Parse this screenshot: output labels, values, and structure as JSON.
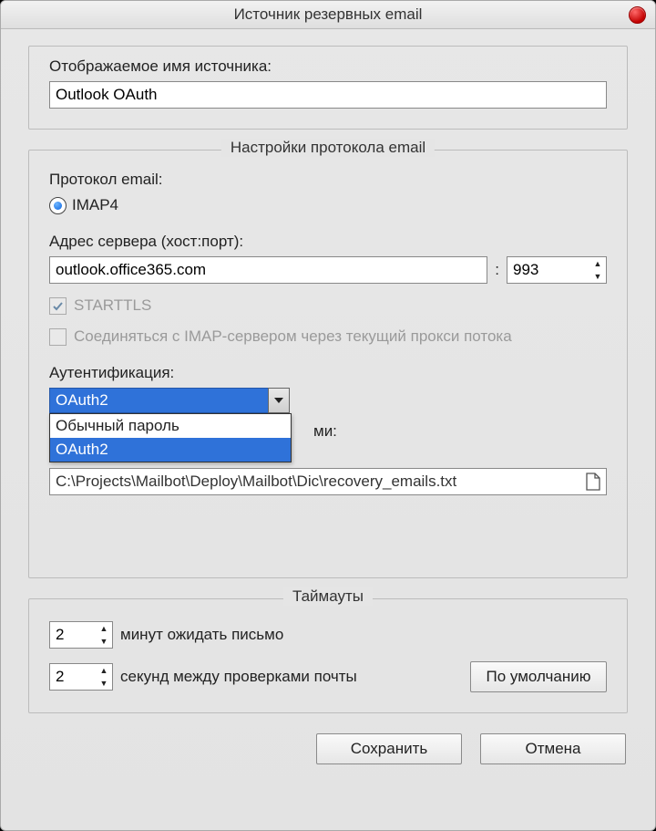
{
  "window": {
    "title": "Источник резервных email"
  },
  "source": {
    "name_label": "Отображаемое имя источника:",
    "name_value": "Outlook OAuth"
  },
  "protocol": {
    "legend": "Настройки протокола email",
    "protocol_label": "Протокол email:",
    "protocol_value": "IMAP4",
    "server_label": "Адрес сервера (хост:порт):",
    "host_value": "outlook.office365.com",
    "port_sep": ":",
    "port_value": "993",
    "starttls_label": "STARTTLS",
    "starttls_checked": true,
    "proxy_label": "Соединяться с IMAP-сервером через текущий прокси потока",
    "proxy_checked": false,
    "auth_label": "Аутентификация:",
    "auth_value": "OAuth2",
    "auth_options": [
      "Обычный пароль",
      "OAuth2"
    ],
    "file_label_partial": "ми:",
    "file_value": "C:\\Projects\\Mailbot\\Deploy\\Mailbot\\Dic\\recovery_emails.txt"
  },
  "timeouts": {
    "legend": "Таймауты",
    "wait_value": "2",
    "wait_label": "минут ожидать письмо",
    "interval_value": "2",
    "interval_label": "секунд между проверками почты",
    "defaults_btn": "По умолчанию"
  },
  "footer": {
    "save": "Сохранить",
    "cancel": "Отмена"
  }
}
